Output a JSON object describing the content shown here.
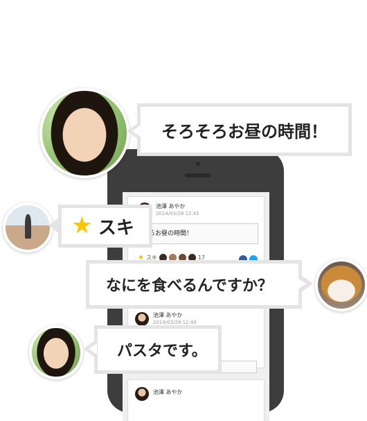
{
  "bubbles": {
    "lunch": "そろそろお昼の時間！",
    "like": "スキ",
    "question": "なにを食べるんですか？",
    "answer": "パスタです。"
  },
  "feed": {
    "post1": {
      "author": "池澤 あやか",
      "time": "2014/03/28 12:41",
      "text": "そろお昼の時間！",
      "like_label": "スキ",
      "like_count": "17"
    },
    "post2": {
      "author": "池澤 あやか",
      "time": "2014/03/28 12:49"
    },
    "post3": {
      "author": "池澤 あやか"
    }
  },
  "icons": {
    "like": "star-icon",
    "share1": "facebook-icon",
    "share2": "twitter-icon"
  },
  "colors": {
    "star": "#f5c800",
    "bubble_border": "#e4e4e4",
    "phone": "#3d3d3d"
  }
}
